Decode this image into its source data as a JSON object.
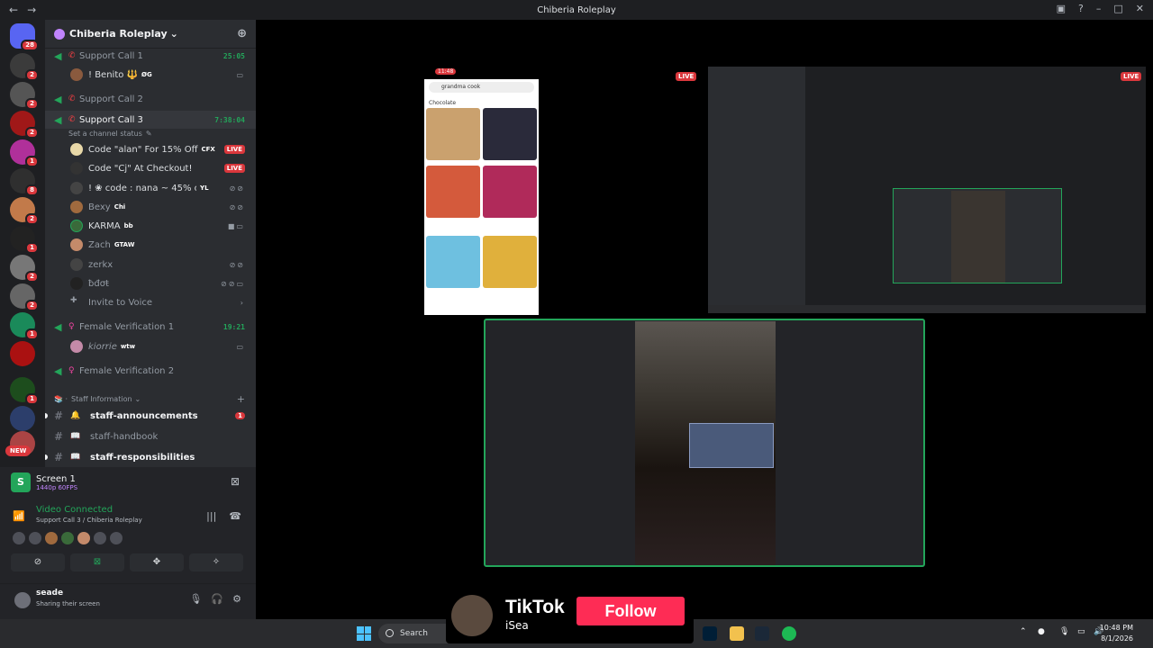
{
  "window": {
    "title": "Chiberia Roleplay"
  },
  "guilds": {
    "home_badge": "28",
    "badges": [
      "2",
      "2",
      "2",
      "1",
      "8",
      "2",
      "1",
      "2",
      "2",
      "1",
      "1"
    ],
    "new_label": "NEW"
  },
  "server": {
    "name": "Chiberia Roleplay"
  },
  "channels": {
    "support1": {
      "name": "Support Call 1",
      "timer": "25:05"
    },
    "benito": {
      "name": "! Benito 🔱",
      "tag": "ØG"
    },
    "support2": {
      "name": "Support Call 2"
    },
    "support3": {
      "name": "Support Call 3",
      "timer": "7:38:04",
      "status": "Set a channel status"
    },
    "users3": [
      {
        "name": "Code \"alan\" For 15% Off",
        "tag": "CFX",
        "live": "LIVE"
      },
      {
        "name": "Code \"Cj\" At Checkout!",
        "live": "LIVE"
      },
      {
        "name": "! ❀ code : nana ~ 45% off ❀",
        "tag": "YL"
      },
      {
        "name": "Bexy",
        "tag": "Chi"
      },
      {
        "name": "KARMA",
        "tag": "bb"
      },
      {
        "name": "Zach",
        "tag": "GTAW"
      },
      {
        "name": "zerkx"
      },
      {
        "name": "ƀđσŧ"
      }
    ],
    "invite": "Invite to Voice",
    "female1": {
      "name": "Female Verification 1",
      "timer": "19:21"
    },
    "kiorrie": {
      "name": "kiorrie",
      "tag": "wtw"
    },
    "female2": {
      "name": "Female Verification 2"
    },
    "staff_cat": "Staff Information",
    "text": [
      {
        "name": "staff-announcements",
        "badge": "1",
        "emoji": "🔔"
      },
      {
        "name": "staff-handbook",
        "emoji": "📖"
      },
      {
        "name": "staff-responsibilities",
        "emoji": "📖"
      }
    ]
  },
  "screen": {
    "name": "Screen 1",
    "quality": "1440p 60FPS"
  },
  "voice": {
    "status": "Video Connected",
    "location": "Support Call 3 / Chiberia Roleplay"
  },
  "user": {
    "name": "seade",
    "status": "Sharing their screen"
  },
  "stage": {
    "live": "LIVE",
    "phone_time": "11:48",
    "phone_query": "grandma cook",
    "phone_chip": "Chocolate"
  },
  "taskbar": {
    "search": "Search",
    "time": "10:48 PM",
    "date": "8/1/2026"
  },
  "tiktok": {
    "brand": "TikTok",
    "handle": "iSea",
    "follow": "Follow"
  },
  "colors": {
    "accent": "#23a55a",
    "live": "#da373c",
    "tiktok": "#fe2c55"
  }
}
